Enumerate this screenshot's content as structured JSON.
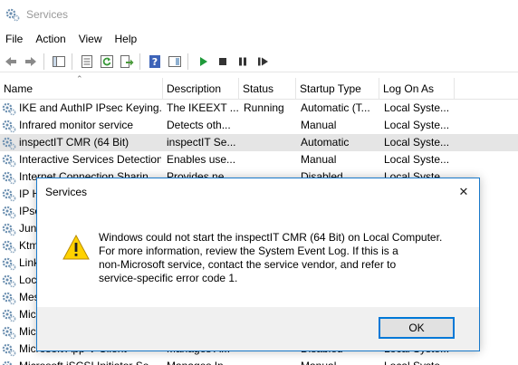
{
  "window": {
    "title": "Services"
  },
  "menu": [
    "File",
    "Action",
    "View",
    "Help"
  ],
  "toolbar": {
    "icons": [
      "back-arrow-icon",
      "forward-arrow-icon",
      "console-tree-icon",
      "properties-icon",
      "refresh-icon",
      "export-list-icon",
      "help-icon",
      "console-view-icon",
      "start-service-icon",
      "stop-service-icon",
      "pause-service-icon",
      "restart-service-icon"
    ]
  },
  "columns": [
    "Name",
    "Description",
    "Status",
    "Startup Type",
    "Log On As"
  ],
  "services": [
    {
      "name": "IKE and AuthIP IPsec Keying...",
      "description": "The IKEEXT ...",
      "status": "Running",
      "startup": "Automatic (T...",
      "logon": "Local Syste..."
    },
    {
      "name": "Infrared monitor service",
      "description": "Detects oth...",
      "status": "",
      "startup": "Manual",
      "logon": "Local Syste..."
    },
    {
      "name": "inspectIT CMR (64 Bit)",
      "description": "inspectIT Se...",
      "status": "",
      "startup": "Automatic",
      "logon": "Local Syste..."
    },
    {
      "name": "Interactive Services Detection",
      "description": "Enables use...",
      "status": "",
      "startup": "Manual",
      "logon": "Local Syste..."
    },
    {
      "name": "Internet Connection Sharin...",
      "description": "Provides ne...",
      "status": "",
      "startup": "Disabled",
      "logon": "Local Syste..."
    },
    {
      "name": "IP H",
      "description": "",
      "status": "",
      "startup": "",
      "logon": ""
    },
    {
      "name": "IPse",
      "description": "",
      "status": "",
      "startup": "",
      "logon": ""
    },
    {
      "name": "Juni",
      "description": "",
      "status": "",
      "startup": "",
      "logon": ""
    },
    {
      "name": "Ktm",
      "description": "",
      "status": "",
      "startup": "",
      "logon": ""
    },
    {
      "name": "Link",
      "description": "",
      "status": "",
      "startup": "",
      "logon": ""
    },
    {
      "name": "Loca",
      "description": "",
      "status": "",
      "startup": "",
      "logon": ""
    },
    {
      "name": "Mes",
      "description": "",
      "status": "",
      "startup": "",
      "logon": ""
    },
    {
      "name": "Mic",
      "description": "",
      "status": "",
      "startup": "",
      "logon": ""
    },
    {
      "name": "Mic",
      "description": "",
      "status": "",
      "startup": "",
      "logon": ""
    },
    {
      "name": "Microsoft App-V Client",
      "description": "Manages A...",
      "status": "",
      "startup": "Disabled",
      "logon": "Local Syste..."
    },
    {
      "name": "Microsoft iSCSI Initiator Se...",
      "description": "Manages In...",
      "status": "",
      "startup": "Manual",
      "logon": "Local Syste..."
    }
  ],
  "selected_index": 2,
  "dialog": {
    "title": "Services",
    "message_lines": [
      "Windows could not start the inspectIT CMR (64 Bit) on Local Computer.",
      "For more information, review the System Event Log. If this is a",
      "non-Microsoft service, contact the service vendor, and refer to",
      "service-specific error code 1."
    ],
    "ok_label": "OK",
    "close_glyph": "✕"
  },
  "colors": {
    "accent": "#0078d7",
    "dialog_border": "#1979ca",
    "selected_row": "#e5e5e5",
    "warning": "#ffd200"
  }
}
